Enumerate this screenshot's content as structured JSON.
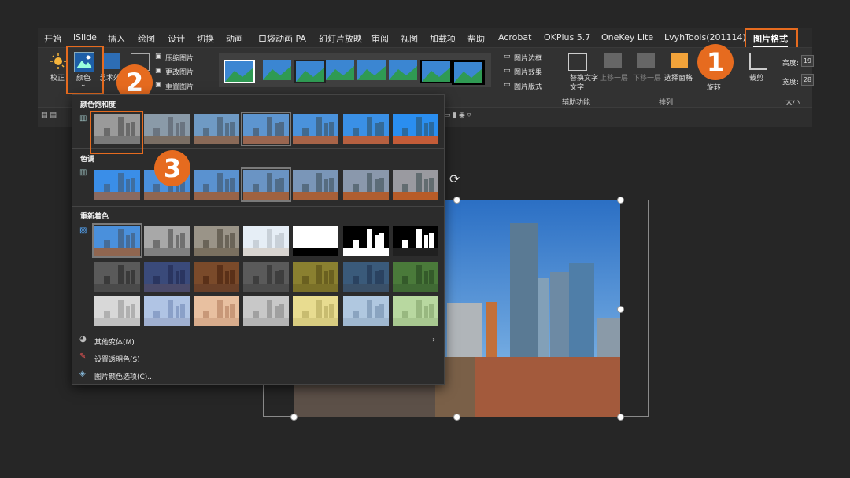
{
  "tabs": [
    "开始",
    "iSlide",
    "插入",
    "绘图",
    "设计",
    "切换",
    "动画",
    "口袋动画 PA",
    "幻灯片放映",
    "审阅",
    "视图",
    "加载项",
    "帮助",
    "Acrobat",
    "OKPlus 5.7",
    "OneKey Lite",
    "LvyhTools(201114)",
    "图片格式"
  ],
  "ribbon": {
    "correct": "校正",
    "color": "颜色",
    "art": "艺术效果",
    "compress": "压缩图片",
    "change": "更改图片",
    "reset": "重置图片",
    "border": "图片边框",
    "effect": "图片效果",
    "layout": "图片版式",
    "alt_text": "替换文字",
    "alt_text2": "文字",
    "accessibility_group": "辅助功能",
    "bring_forward": "上移一层",
    "send_backward": "下移一层",
    "selection_pane": "选择窗格",
    "rotate": "旋转",
    "arrange_group": "排列",
    "crop": "裁剪",
    "height_label": "高度:",
    "height_value": "19",
    "width_label": "宽度:",
    "width_value": "28",
    "size_group": "大小"
  },
  "menu": {
    "saturation": "颜色饱和度",
    "tone": "色调",
    "recolor": "重新着色",
    "more_variants": "其他变体(M)",
    "set_transparent": "设置透明色(S)",
    "color_options": "图片颜色选项(C)..."
  },
  "badges": [
    "1",
    "2",
    "3"
  ],
  "colors": {
    "accent": "#e66b1f",
    "ribbon": "#323232",
    "background": "#262626"
  }
}
